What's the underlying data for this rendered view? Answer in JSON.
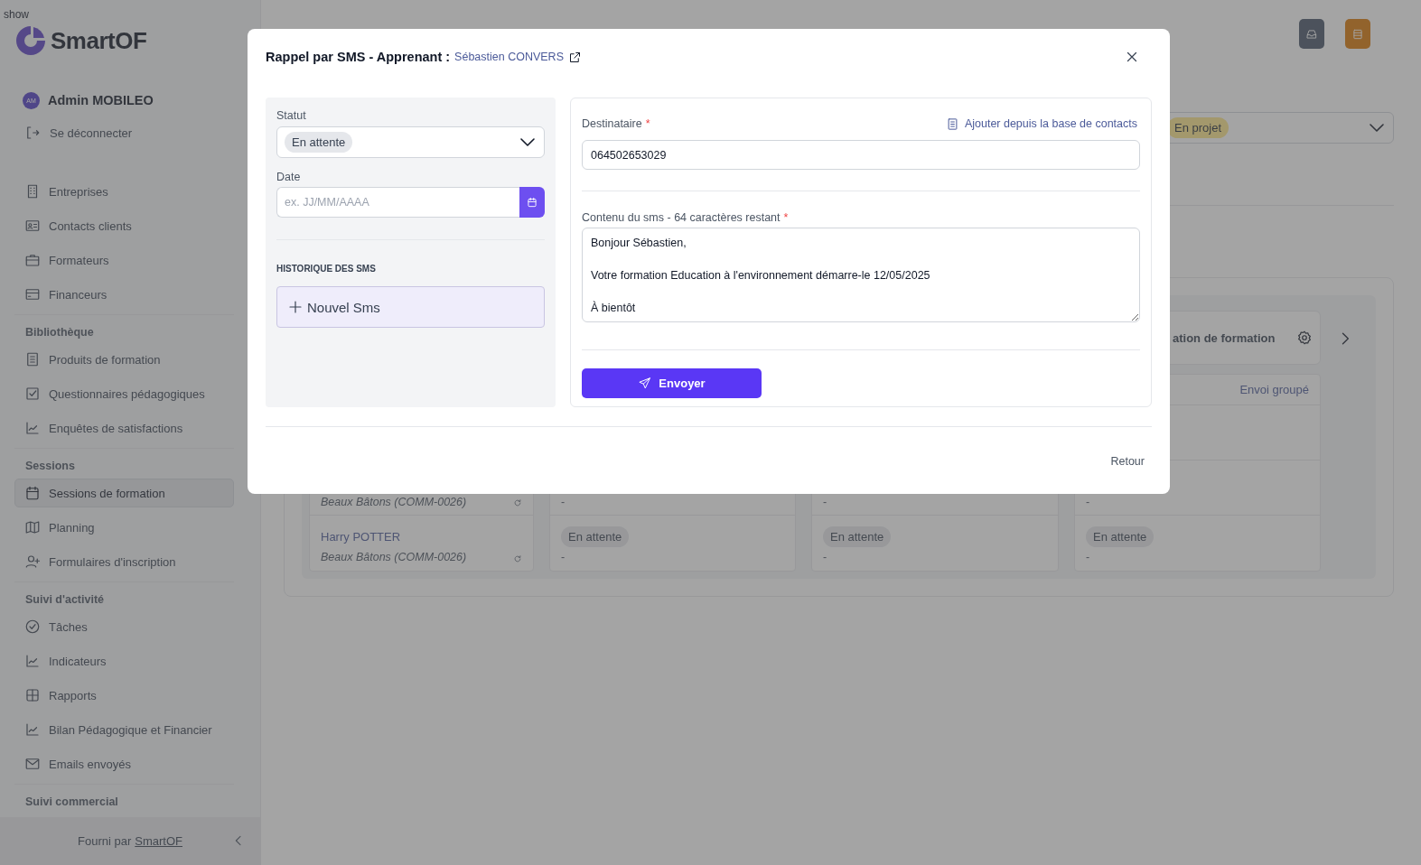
{
  "sidebar": {
    "debug_label": "show",
    "logo": "SmartOF",
    "user": {
      "initials": "AM",
      "name": "Admin MOBILEO"
    },
    "logout": "Se déconnecter",
    "sections": [
      {
        "items": [
          {
            "label": "Entreprises",
            "selected": false
          },
          {
            "label": "Contacts clients",
            "selected": false
          },
          {
            "label": "Formateurs",
            "selected": false
          },
          {
            "label": "Financeurs",
            "selected": false
          }
        ]
      },
      {
        "title": "Bibliothèque",
        "items": [
          {
            "label": "Produits de formation",
            "selected": false
          },
          {
            "label": "Questionnaires pédagogiques",
            "selected": false
          },
          {
            "label": "Enquêtes de satisfactions",
            "selected": false
          }
        ]
      },
      {
        "title": "Sessions",
        "items": [
          {
            "label": "Sessions de formation",
            "selected": true
          },
          {
            "label": "Planning",
            "selected": false
          },
          {
            "label": "Formulaires d'inscription",
            "selected": false
          }
        ]
      },
      {
        "title": "Suivi d'activité",
        "items": [
          {
            "label": "Tâches",
            "selected": false
          },
          {
            "label": "Indicateurs",
            "selected": false
          },
          {
            "label": "Rapports",
            "selected": false
          },
          {
            "label": "Bilan Pédagogique et Financier",
            "selected": false
          },
          {
            "label": "Emails envoyés",
            "selected": false
          }
        ]
      },
      {
        "title": "Suivi commercial"
      }
    ],
    "footer": {
      "prefix": "Fourni par",
      "link": "SmartOF"
    }
  },
  "page": {
    "status_select": {
      "value": "En projet"
    },
    "board": {
      "column_4_header": "ation de formation",
      "group_send": "Envoi groupé",
      "rows": [
        {
          "company": "Beaux Bâtons (COMM-0026)",
          "cells": [
            {
              "value": "-"
            },
            {
              "value": "-"
            },
            {
              "value": "-"
            }
          ]
        },
        {
          "learner": "Harry POTTER",
          "company": "Beaux Bâtons (COMM-0026)",
          "cells": [
            {
              "status": "En attente",
              "value": "-"
            },
            {
              "status": "En attente",
              "value": "-"
            },
            {
              "status": "En attente",
              "value": "-"
            }
          ]
        }
      ]
    }
  },
  "modal": {
    "title": "Rappel par SMS - Apprenant :",
    "learner_link": "Sébastien CONVERS",
    "status": {
      "label": "Statut",
      "value": "En attente"
    },
    "date": {
      "label": "Date",
      "placeholder": "ex. JJ/MM/AAAA"
    },
    "history": {
      "title": "HISTORIQUE DES SMS",
      "new_button": "Nouvel Sms"
    },
    "recipient": {
      "label": "Destinataire",
      "required_mark": "*",
      "contacts_link": "Ajouter depuis la base de contacts",
      "value": "064502653029"
    },
    "content": {
      "label": "Contenu du sms - 64 caractères restant",
      "required_mark": "*",
      "value": "Bonjour Sébastien,\n\nVotre formation Education à l'environnement démarre-le 12/05/2025\n\nÀ bientôt"
    },
    "send_button": "Envoyer",
    "back_button": "Retour"
  }
}
